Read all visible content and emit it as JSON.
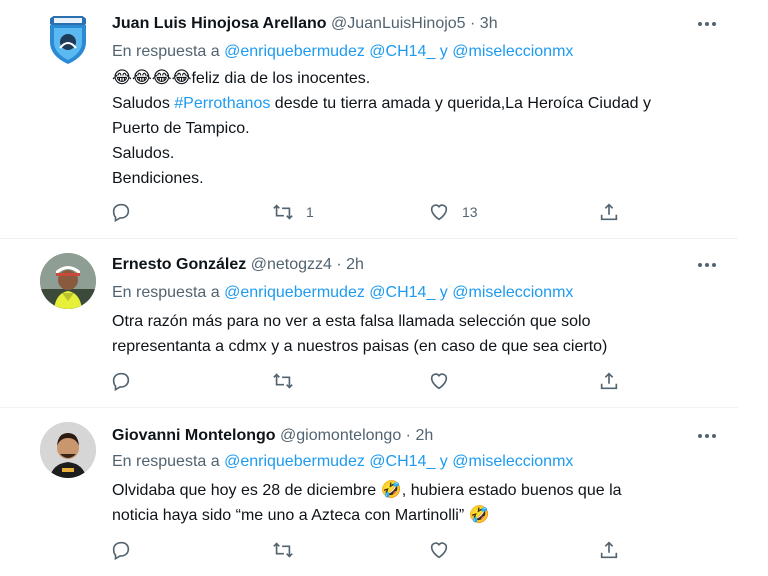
{
  "tweets": [
    {
      "name": "Juan Luis Hinojosa Arellano",
      "handle": "@JuanLuisHinojo5",
      "separator": "·",
      "time": "3h",
      "reply_prefix": "En respuesta a",
      "reply_mention_1": "@enriquebermudez",
      "reply_mention_2": "@CH14_",
      "reply_conjunction": "y",
      "reply_mention_3": "@miseleccionmx",
      "body": {
        "line1_emoji": "😂😂😂😂",
        "line1_text": "feliz dia de los inocentes.",
        "line2_pre": "Saludos",
        "line2_hashtag": "#Perrothanos",
        "line2_post": "desde tu tierra amada y querida,La Heroíca Ciudad y",
        "line3": "Puerto de Tampico.",
        "line4": "Saludos.",
        "line5": "Bendiciones."
      },
      "retweets": "1",
      "likes": "13",
      "avatar_icon": "team-crest"
    },
    {
      "name": "Ernesto González",
      "handle": "@netogzz4",
      "separator": "·",
      "time": "2h",
      "reply_prefix": "En respuesta a",
      "reply_mention_1": "@enriquebermudez",
      "reply_mention_2": "@CH14_",
      "reply_conjunction": "y",
      "reply_mention_3": "@miseleccionmx",
      "body": {
        "line1": "Otra razón más para no ver a esta falsa llamada selección que solo",
        "line2": "representanta a cdmx y a nuestros paisas  (en caso de que sea cierto)"
      },
      "retweets": "",
      "likes": "",
      "avatar_icon": "person-photo"
    },
    {
      "name": "Giovanni Montelongo",
      "handle": "@giomontelongo",
      "separator": "·",
      "time": "2h",
      "reply_prefix": "En respuesta a",
      "reply_mention_1": "@enriquebermudez",
      "reply_mention_2": "@CH14_",
      "reply_conjunction": "y",
      "reply_mention_3": "@miseleccionmx",
      "body": {
        "line1_text": "Olvidaba que hoy es 28 de diciembre",
        "line1_emoji": "🤣",
        "line1_post": ", hubiera estado buenos que la",
        "line2_text": "noticia haya sido “me uno a Azteca con Martinolli”",
        "line2_emoji": "🤣"
      },
      "retweets": "",
      "likes": "",
      "avatar_icon": "person-photo"
    }
  ],
  "colors": {
    "link": "#1d9bf0",
    "secondary_text": "#536471",
    "primary_text": "#0f1419",
    "divider": "#eff3f4"
  },
  "icons": [
    "reply-icon",
    "retweet-icon",
    "like-icon",
    "share-icon",
    "more-options-icon"
  ]
}
